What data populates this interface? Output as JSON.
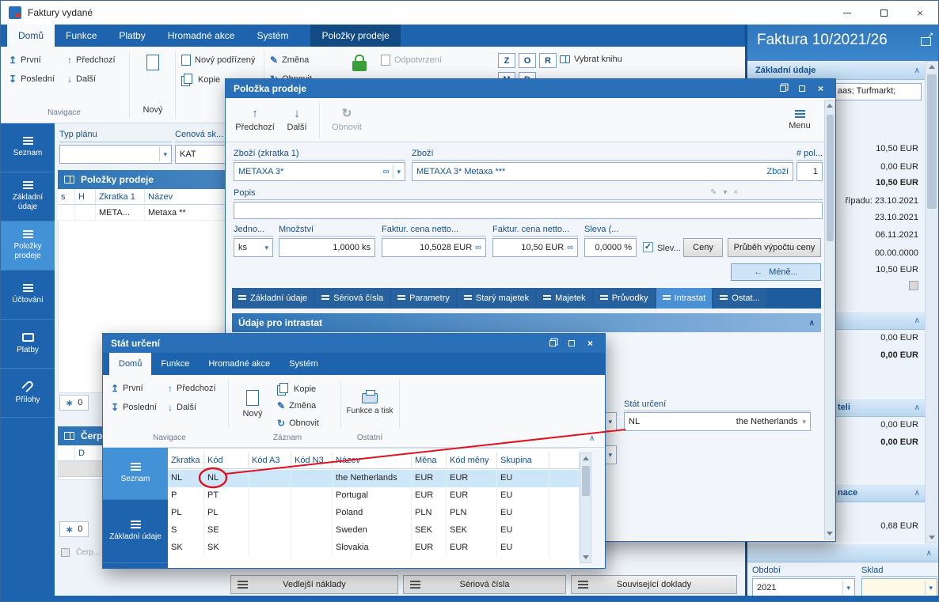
{
  "colors": {
    "accent": "#2a70b8",
    "ribbon_blue": "#1e63ad",
    "selection": "#cde6f8",
    "annotation_red": "#e0121e"
  },
  "icons": {
    "arrow_up": "↑",
    "arrow_down": "↓",
    "arrow_first": "↥",
    "arrow_last": "↧",
    "refresh": "↻",
    "dropdown": "▾",
    "chevron_up": "∧",
    "link": "∞",
    "pencil": "✎",
    "close": "×",
    "check": "✓",
    "back": "←",
    "asterisk": "∗",
    "external": "↗"
  },
  "window": {
    "title": "Faktury vydané"
  },
  "main_ribbon": {
    "tabs": [
      {
        "label": "Domů",
        "active": true
      },
      {
        "label": "Funkce"
      },
      {
        "label": "Platby"
      },
      {
        "label": "Hromadné akce"
      },
      {
        "label": "Systém"
      },
      {
        "label": "Položky prodeje",
        "contextual": true
      }
    ],
    "nav_first": "První",
    "nav_prev": "Předchozí",
    "nav_last": "Poslední",
    "nav_next": "Další",
    "new_label": "Nový",
    "new_child": "Nový podřízený",
    "copy": "Kopie",
    "change": "Změna",
    "refresh": "Obnovit",
    "unconfirm": "Odpotvrzení",
    "flags_row1": [
      "Z",
      "O",
      "R"
    ],
    "flags_row2": [
      "M",
      "D"
    ],
    "select_book": "Vybrat knihu",
    "group_navigace": "Navigace"
  },
  "main_sidebar": {
    "items": [
      {
        "label": "Seznam"
      },
      {
        "label": "Základní údaje"
      },
      {
        "label": "Položky prodeje",
        "active": true
      },
      {
        "label": "Účtování"
      },
      {
        "label": "Platby"
      },
      {
        "label": "Přílohy"
      }
    ]
  },
  "content": {
    "typ_planu_label": "Typ plánu",
    "cenova_label": "Cenová sk...",
    "cenova_value": "KAT",
    "items_header": "Položky prodeje",
    "items_table": {
      "columns": [
        "s",
        "H",
        "Zkratka 1",
        "Název"
      ],
      "rows": [
        {
          "zkratka": "META...",
          "nazev": "Metaxa **"
        }
      ]
    },
    "count1": "0",
    "cerpani_header": "Čerpání",
    "cerpani_col": "D",
    "count2": "0",
    "cerpani_check_label": "Čerp...",
    "footer_buttons": [
      "Vedlejší náklady",
      "Sériová čísla",
      "Související doklady"
    ]
  },
  "right_panel": {
    "title": "Faktura 10/2021/26",
    "section1_header": "Základní údaje",
    "address_fragment": "aas; Turfmarkt;",
    "rows": [
      {
        "value": "10,50 EUR"
      },
      {
        "value": "0,00 EUR"
      },
      {
        "value": "10,50 EUR"
      },
      {
        "label": "řípadu:",
        "value": "23.10.2021"
      },
      {
        "value": "23.10.2021"
      },
      {
        "value": "06.11.2021"
      },
      {
        "value": "00.00.0000"
      },
      {
        "value": "10,50 EUR"
      }
    ],
    "section2_rows": [
      {
        "value": "0,00 EUR"
      },
      {
        "value": "0,00 EUR"
      }
    ],
    "section3_header_fragment": "teli",
    "section3_rows": [
      {
        "value": "0,00 EUR"
      },
      {
        "value": "0,00 EUR"
      }
    ],
    "section4_header_fragment": "nace",
    "section4_value": "0,68 EUR",
    "obdobi_label": "Období",
    "obdobi_value": "2021",
    "sklad_label": "Sklad"
  },
  "item_dialog": {
    "title": "Položka prodeje",
    "prev": "Předchozí",
    "next": "Další",
    "refresh": "Obnovit",
    "menu": "Menu",
    "zbozi_zkratka_label": "Zboží (zkratka 1)",
    "zbozi_zkratka_value": "METAXA 3*",
    "zbozi_label": "Zboží",
    "zbozi_value": "METAXA 3* Metaxa ***",
    "zbozi_link": "Zboží",
    "pol_label": "# pol...",
    "pol_value": "1",
    "popis_label": "Popis",
    "jednotka_label": "Jedno...",
    "jednotka_value": "ks",
    "mnozstvi_label": "Množství",
    "mnozstvi_value": "1,0000 ks",
    "cena_netto1_label": "Faktur. cena netto...",
    "cena_netto1_value": "10,5028 EUR",
    "cena_netto2_label": "Faktur. cena netto...",
    "cena_netto2_value": "10,50 EUR",
    "sleva_label": "Sleva (...",
    "sleva_value": "0,0000 %",
    "sleva_check_label": "Slev...",
    "sleva_checked": true,
    "ceny_button": "Ceny",
    "prubeh_button": "Průběh výpočtu ceny",
    "mene_button": "Méně...",
    "tabs": [
      {
        "label": "Základní údaje"
      },
      {
        "label": "Sériová čísla"
      },
      {
        "label": "Parametry"
      },
      {
        "label": "Starý majetek"
      },
      {
        "label": "Majetek"
      },
      {
        "label": "Průvodky"
      },
      {
        "label": "Intrastat",
        "active": true
      },
      {
        "label": "Ostat..."
      }
    ],
    "intrastat_header": "Údaje pro intrastat",
    "stat_urceni_label": "Stát určení",
    "stat_urceni_code": "NL",
    "stat_urceni_name": "the Netherlands"
  },
  "country_dialog": {
    "title": "Stát určení",
    "tabs": [
      {
        "label": "Domů",
        "active": true
      },
      {
        "label": "Funkce"
      },
      {
        "label": "Hromadné akce"
      },
      {
        "label": "Systém"
      }
    ],
    "first": "První",
    "last": "Poslední",
    "prev": "Předchozí",
    "next": "Další",
    "new_label": "Nový",
    "copy": "Kopie",
    "change": "Změna",
    "refresh": "Obnovit",
    "print_button": "Funkce a tisk",
    "group_navigace": "Navigace",
    "group_zaznam": "Záznam",
    "group_ostatni": "Ostatní",
    "sidebar": [
      {
        "label": "Seznam",
        "active": true
      },
      {
        "label": "Základní údaje"
      }
    ],
    "table": {
      "columns": [
        "Zkratka",
        "Kód",
        "Kód A3",
        "Kód N3",
        "Název",
        "Měna",
        "Kód měny",
        "Skupina"
      ],
      "rows": [
        {
          "zkratka": "NL",
          "kod": "NL",
          "kod_a3": "",
          "kod_n3": "",
          "nazev": "the Netherlands",
          "mena": "EUR",
          "kod_meny": "EUR",
          "skupina": "EU",
          "selected": true
        },
        {
          "zkratka": "P",
          "kod": "PT",
          "kod_a3": "",
          "kod_n3": "",
          "nazev": "Portugal",
          "mena": "EUR",
          "kod_meny": "EUR",
          "skupina": "EU"
        },
        {
          "zkratka": "PL",
          "kod": "PL",
          "kod_a3": "",
          "kod_n3": "",
          "nazev": "Poland",
          "mena": "PLN",
          "kod_meny": "PLN",
          "skupina": "EU"
        },
        {
          "zkratka": "S",
          "kod": "SE",
          "kod_a3": "",
          "kod_n3": "",
          "nazev": "Sweden",
          "mena": "SEK",
          "kod_meny": "SEK",
          "skupina": "EU"
        },
        {
          "zkratka": "SK",
          "kod": "SK",
          "kod_a3": "",
          "kod_n3": "",
          "nazev": "Slovakia",
          "mena": "EUR",
          "kod_meny": "EUR",
          "skupina": "EU"
        }
      ]
    }
  }
}
